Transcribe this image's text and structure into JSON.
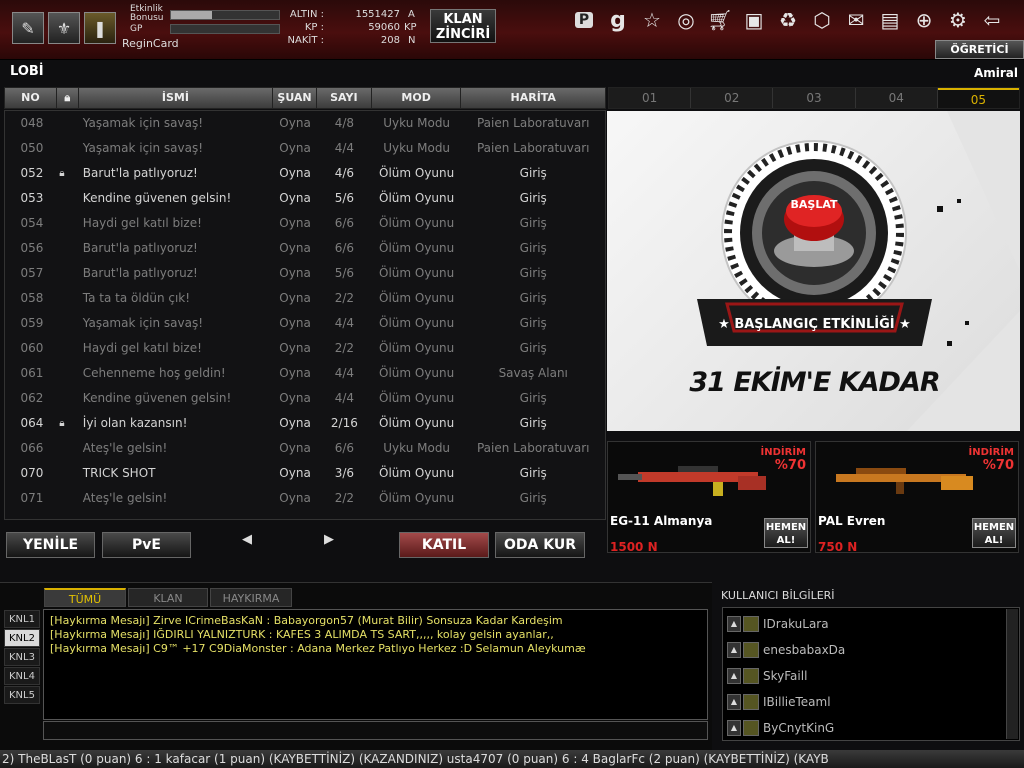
{
  "top": {
    "etkinlik": "Etkinlik",
    "bonusu": "Bonusu",
    "gp": "GP",
    "region": "ReginCard",
    "bonus_fill": 0.38,
    "gp_fill": 0.0,
    "currencies": [
      {
        "label": "ALTIN :",
        "value": "1551427",
        "unit": "A"
      },
      {
        "label": "KP :",
        "value": "59060",
        "unit": "KP"
      },
      {
        "label": "NAKİT :",
        "value": "208",
        "unit": "N"
      }
    ],
    "klan_line1": "KLAN",
    "klan_line2": "ZİNCİRİ",
    "ogretici": "ÖĞRETİCİ",
    "icons": [
      "p-logo-icon",
      "g-logo-icon",
      "star-icon",
      "medal-icon",
      "cart-icon",
      "briefcase-icon",
      "recycle-icon",
      "box-icon",
      "mail-icon",
      "profile-card-icon",
      "globe-icon",
      "gear-icon",
      "back-arrow-icon"
    ]
  },
  "lobby": {
    "title": "LOBİ",
    "rank": "Amiral",
    "columns": [
      "NO",
      "",
      "İSMİ",
      "ŞUAN",
      "SAYI",
      "MOD",
      "HARİTA"
    ],
    "rooms": [
      {
        "no": "048",
        "lock": false,
        "name": "Yaşamak için savaş!",
        "status": "Oyna",
        "count": "4/8",
        "mode": "Uyku Modu",
        "map": "Paien Laboratuvarı",
        "bright": false
      },
      {
        "no": "050",
        "lock": false,
        "name": "Yaşamak için savaş!",
        "status": "Oyna",
        "count": "4/4",
        "mode": "Uyku Modu",
        "map": "Paien Laboratuvarı",
        "bright": false
      },
      {
        "no": "052",
        "lock": true,
        "name": "Barut'la patlıyoruz!",
        "status": "Oyna",
        "count": "4/6",
        "mode": "Ölüm Oyunu",
        "map": "Giriş",
        "bright": true
      },
      {
        "no": "053",
        "lock": false,
        "name": "Kendine güvenen gelsin!",
        "status": "Oyna",
        "count": "5/6",
        "mode": "Ölüm Oyunu",
        "map": "Giriş",
        "bright": true
      },
      {
        "no": "054",
        "lock": false,
        "name": "Haydi gel katıl bize!",
        "status": "Oyna",
        "count": "6/6",
        "mode": "Ölüm Oyunu",
        "map": "Giriş",
        "bright": false
      },
      {
        "no": "056",
        "lock": false,
        "name": "Barut'la patlıyoruz!",
        "status": "Oyna",
        "count": "6/6",
        "mode": "Ölüm Oyunu",
        "map": "Giriş",
        "bright": false
      },
      {
        "no": "057",
        "lock": false,
        "name": "Barut'la patlıyoruz!",
        "status": "Oyna",
        "count": "5/6",
        "mode": "Ölüm Oyunu",
        "map": "Giriş",
        "bright": false
      },
      {
        "no": "058",
        "lock": false,
        "name": "Ta ta ta öldün çık!",
        "status": "Oyna",
        "count": "2/2",
        "mode": "Ölüm Oyunu",
        "map": "Giriş",
        "bright": false
      },
      {
        "no": "059",
        "lock": false,
        "name": "Yaşamak için savaş!",
        "status": "Oyna",
        "count": "4/4",
        "mode": "Ölüm Oyunu",
        "map": "Giriş",
        "bright": false
      },
      {
        "no": "060",
        "lock": false,
        "name": "Haydi gel katıl bize!",
        "status": "Oyna",
        "count": "2/2",
        "mode": "Ölüm Oyunu",
        "map": "Giriş",
        "bright": false
      },
      {
        "no": "061",
        "lock": false,
        "name": "Cehenneme hoş geldin!",
        "status": "Oyna",
        "count": "4/4",
        "mode": "Ölüm Oyunu",
        "map": "Savaş Alanı",
        "bright": false
      },
      {
        "no": "062",
        "lock": false,
        "name": "Kendine güvenen gelsin!",
        "status": "Oyna",
        "count": "4/4",
        "mode": "Ölüm Oyunu",
        "map": "Giriş",
        "bright": false
      },
      {
        "no": "064",
        "lock": true,
        "name": "İyi olan kazansın!",
        "status": "Oyna",
        "count": "2/16",
        "mode": "Ölüm Oyunu",
        "map": "Giriş",
        "bright": true
      },
      {
        "no": "066",
        "lock": false,
        "name": "Ateş'le gelsin!",
        "status": "Oyna",
        "count": "6/6",
        "mode": "Uyku Modu",
        "map": "Paien Laboratuvarı",
        "bright": false
      },
      {
        "no": "070",
        "lock": false,
        "name": "TRICK SHOT",
        "status": "Oyna",
        "count": "3/6",
        "mode": "Ölüm Oyunu",
        "map": "Giriş",
        "bright": true
      },
      {
        "no": "071",
        "lock": false,
        "name": "Ateş'le gelsin!",
        "status": "Oyna",
        "count": "2/2",
        "mode": "Ölüm Oyunu",
        "map": "Giriş",
        "bright": false
      }
    ],
    "btn_yenile": "YENİLE",
    "btn_pve": "PvE",
    "btn_katil": "KATIL",
    "btn_odakur": "ODA KUR"
  },
  "banner": {
    "tabs": [
      "01",
      "02",
      "03",
      "04",
      "05"
    ],
    "selected_tab": 4,
    "button_text": "BAŞLAT",
    "ribbon": "★ BAŞLANGIÇ ETKİNLİĞİ ★",
    "deadline": "31 EKİM'E KADAR"
  },
  "shop": [
    {
      "discount_label": "İNDİRİM",
      "discount": "%70",
      "name": "EG-11 Almanya",
      "price": "1500 N",
      "buy1": "HEMEN",
      "buy2": "AL!"
    },
    {
      "discount_label": "İNDİRİM",
      "discount": "%70",
      "name": "PAL Evren",
      "price": "750 N",
      "buy1": "HEMEN",
      "buy2": "AL!"
    }
  ],
  "chat": {
    "tabs": [
      "TÜMÜ",
      "KLAN",
      "HAYKIRMA"
    ],
    "channels": [
      "KNL1",
      "KNL2",
      "KNL3",
      "KNL4",
      "KNL5"
    ],
    "selected_channel": 1,
    "messages": [
      "[Haykırma Mesajı]  Zirve ICrimeBasKaN  : Babayorgon57 (Murat Bilir) Sonsuza Kadar Kardeşim",
      "[Haykırma Mesajı]  IĞDIRLI YALNIZTURK  : KAFES 3 ALIMDA TS SART,,,,, kolay gelsin ayanlar,,",
      "[Haykırma Mesajı]  C9™   +17    C9DiaMonster  : Adana Merkez Patlıyo Herkez :D Selamun Aleykumæ"
    ]
  },
  "users": {
    "title": "KULLANICI BİLGİLERİ",
    "list": [
      "IDrakuLara",
      "enesbabaxDa",
      "SkyFaill",
      "IBillieTeaml",
      "ByCnytKinG"
    ]
  },
  "ticker": "2) TheBLasT (0 puan) 6 : 1 kafacar (1 puan) (KAYBETTİNİZ)      (KAZANDINIZ) usta4707 (0 puan) 6 : 4 BaglarFc (2 puan) (KAYBETTİNİZ)      (KAYB"
}
